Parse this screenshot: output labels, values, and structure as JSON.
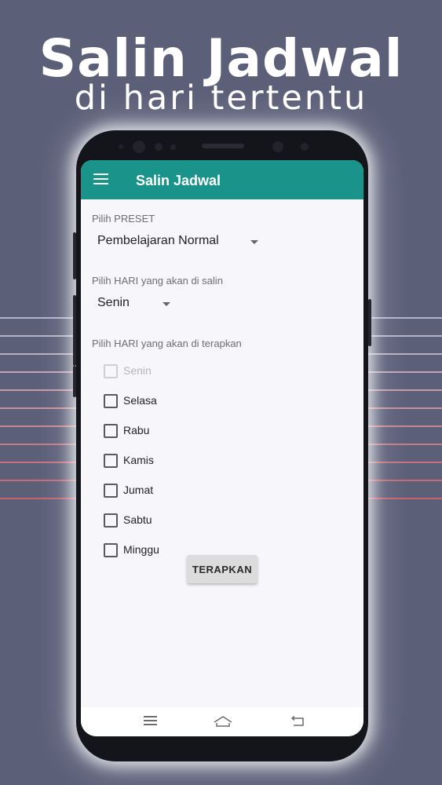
{
  "promo": {
    "title": "Salin Jadwal",
    "subtitle": "di hari tertentu"
  },
  "appbar": {
    "title": "Salin Jadwal",
    "color": "#1a948a"
  },
  "form": {
    "preset_label": "Pilih PRESET",
    "preset_value": "Pembelajaran Normal",
    "copy_day_label": "Pilih HARI yang akan di salin",
    "copy_day_value": "Senin",
    "apply_days_label": "Pilih HARI yang akan di terapkan",
    "days": [
      {
        "label": "Senin",
        "checked": false,
        "enabled": false
      },
      {
        "label": "Selasa",
        "checked": false,
        "enabled": true
      },
      {
        "label": "Rabu",
        "checked": false,
        "enabled": true
      },
      {
        "label": "Kamis",
        "checked": false,
        "enabled": true
      },
      {
        "label": "Jumat",
        "checked": false,
        "enabled": true
      },
      {
        "label": "Sabtu",
        "checked": false,
        "enabled": true
      },
      {
        "label": "Minggu",
        "checked": false,
        "enabled": true
      }
    ],
    "apply_button": "TERAPKAN"
  },
  "icons": {
    "menu": "hamburger-menu-icon",
    "dropdown": "dropdown-caret-icon",
    "nav_recent": "recent-apps-icon",
    "nav_home": "home-icon",
    "nav_back": "back-icon"
  },
  "colors": {
    "background": "#5b5f78",
    "accent": "#1a948a"
  }
}
